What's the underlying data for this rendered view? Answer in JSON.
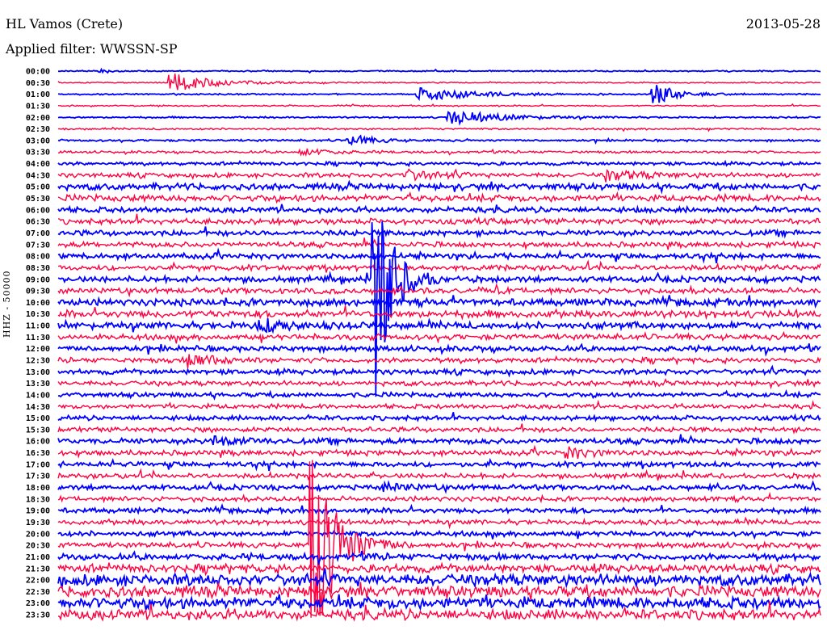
{
  "header": {
    "station": "HL Vamos (Crete)",
    "filter": "Applied filter: WWSSN-SP",
    "date": "2013-05-28"
  },
  "chart_data": {
    "type": "line",
    "title": "HL Vamos (Crete)",
    "subtitle": "Applied filter: WWSSN-SP",
    "ylabel": "HHZ - 50000",
    "xlabel": "",
    "minutes_per_row": 30,
    "colors": [
      "#0000ff",
      "#ff0040"
    ],
    "row_labels": [
      "00:00",
      "00:30",
      "01:00",
      "01:30",
      "02:00",
      "02:30",
      "03:00",
      "03:30",
      "04:00",
      "04:30",
      "05:00",
      "05:30",
      "06:00",
      "06:30",
      "07:00",
      "07:30",
      "08:00",
      "08:30",
      "09:00",
      "09:30",
      "10:00",
      "10:30",
      "11:00",
      "11:30",
      "12:00",
      "12:30",
      "13:00",
      "13:30",
      "14:00",
      "14:30",
      "15:00",
      "15:30",
      "16:00",
      "16:30",
      "17:00",
      "17:30",
      "18:00",
      "18:30",
      "19:00",
      "19:30",
      "20:00",
      "20:30",
      "21:00",
      "21:30",
      "22:00",
      "22:30",
      "23:00",
      "23:30"
    ],
    "noise_level": [
      0.6,
      0.6,
      0.7,
      0.7,
      0.8,
      0.9,
      1.0,
      1.2,
      1.6,
      2.2,
      3.0,
      3.2,
      2.6,
      2.8,
      2.6,
      2.6,
      2.6,
      2.6,
      2.8,
      2.8,
      3.4,
      3.6,
      3.2,
      2.8,
      2.6,
      2.4,
      2.4,
      2.4,
      2.2,
      2.2,
      2.2,
      2.4,
      2.6,
      2.6,
      2.4,
      2.4,
      2.4,
      2.4,
      2.4,
      2.4,
      2.4,
      2.6,
      3.0,
      4.0,
      5.5,
      5.5,
      5.5,
      5.0
    ],
    "events": [
      {
        "row": 0,
        "t": 1.6,
        "amp": 3,
        "dur": 0.4
      },
      {
        "row": 1,
        "t": 4.4,
        "amp": 12,
        "dur": 1.5
      },
      {
        "row": 2,
        "t": 14.2,
        "amp": 9,
        "dur": 1.8
      },
      {
        "row": 2,
        "t": 23.4,
        "amp": 14,
        "dur": 0.8
      },
      {
        "row": 4,
        "t": 15.4,
        "amp": 9,
        "dur": 1.8
      },
      {
        "row": 6,
        "t": 11.4,
        "amp": 8,
        "dur": 0.8
      },
      {
        "row": 7,
        "t": 9.6,
        "amp": 5,
        "dur": 1.0
      },
      {
        "row": 9,
        "t": 13.6,
        "amp": 6,
        "dur": 1.2
      },
      {
        "row": 9,
        "t": 21.6,
        "amp": 6,
        "dur": 1.4
      },
      {
        "row": 18,
        "t": 12.4,
        "amp": 170,
        "dur": 0.6
      },
      {
        "row": 22,
        "t": 7.8,
        "amp": 8,
        "dur": 1.0
      },
      {
        "row": 25,
        "t": 5.2,
        "amp": 9,
        "dur": 1.0
      },
      {
        "row": 32,
        "t": 6.0,
        "amp": 6,
        "dur": 1.0
      },
      {
        "row": 33,
        "t": 20.0,
        "amp": 6,
        "dur": 1.0
      },
      {
        "row": 36,
        "t": 12.8,
        "amp": 5,
        "dur": 1.0
      },
      {
        "row": 41,
        "t": 10.0,
        "amp": 150,
        "dur": 0.8
      }
    ]
  }
}
